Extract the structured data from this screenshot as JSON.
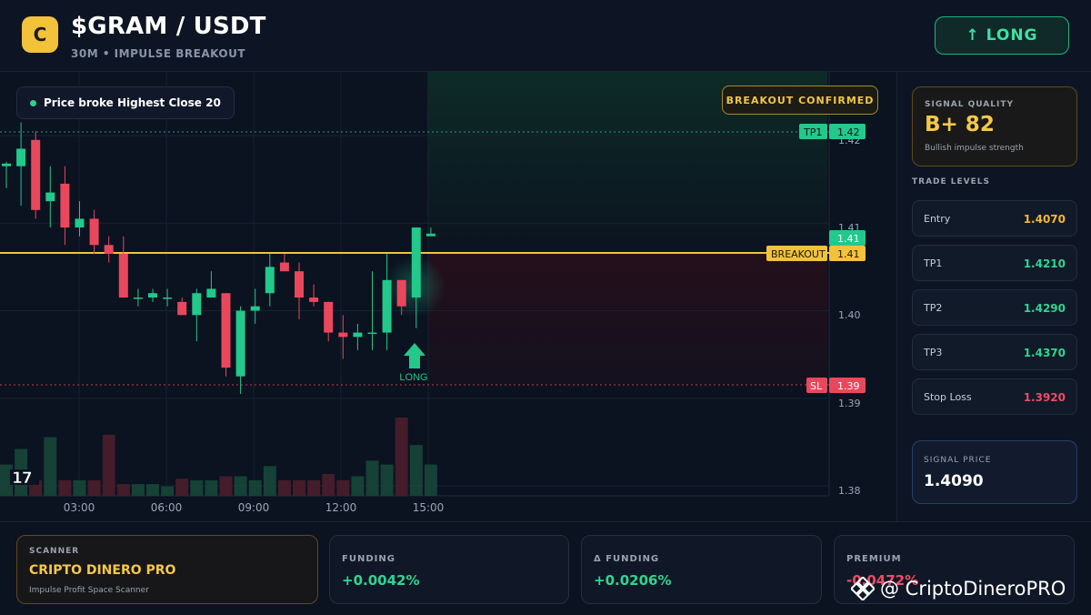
{
  "header": {
    "logo_letter": "C",
    "pair": "$GRAM / USDT",
    "subtitle": "30M • IMPULSE BREAKOUT",
    "direction_button": "↑ LONG"
  },
  "chart": {
    "status_pill": "Price broke Highest Close 20",
    "confirmed_badge": "BREAKOUT CONFIRMED",
    "price_ticks": [
      "1.42",
      "1.41",
      "1.40",
      "1.39",
      "1.38"
    ],
    "time_ticks": [
      "03:00",
      "06:00",
      "09:00",
      "12:00",
      "15:00"
    ],
    "tags": {
      "tp1_label": "TP1",
      "tp1_value": "1.42",
      "current_value": "1.41",
      "breakout_label": "BREAKOUT",
      "breakout_value": "1.41",
      "sl_label": "SL",
      "sl_value": "1.39"
    },
    "long_marker": "LONG",
    "tv_logo": "17",
    "colors": {
      "up": "#22c98a",
      "down": "#e9485c",
      "breakout_line": "#f2c23a"
    }
  },
  "chart_data": {
    "type": "candlestick",
    "x_ticks": [
      "03:00",
      "06:00",
      "09:00",
      "12:00",
      "15:00"
    ],
    "y_ticks": [
      1.42,
      1.41,
      1.4,
      1.39,
      1.38
    ],
    "ylim": [
      1.38,
      1.425
    ],
    "lines": [
      {
        "name": "TP1",
        "value": 1.421
      },
      {
        "name": "BREAKOUT",
        "value": 1.407
      },
      {
        "name": "SL",
        "value": 1.392
      }
    ],
    "candles": [
      {
        "o": 1.4165,
        "h": 1.417,
        "l": 1.414,
        "c": 1.4168
      },
      {
        "o": 1.4165,
        "h": 1.4215,
        "l": 1.412,
        "c": 1.4185
      },
      {
        "o": 1.4195,
        "h": 1.4205,
        "l": 1.4105,
        "c": 1.4115
      },
      {
        "o": 1.4125,
        "h": 1.4165,
        "l": 1.4095,
        "c": 1.4135
      },
      {
        "o": 1.4145,
        "h": 1.4165,
        "l": 1.4075,
        "c": 1.4095
      },
      {
        "o": 1.4095,
        "h": 1.4125,
        "l": 1.4085,
        "c": 1.4105
      },
      {
        "o": 1.4105,
        "h": 1.4115,
        "l": 1.4065,
        "c": 1.4075
      },
      {
        "o": 1.4075,
        "h": 1.4085,
        "l": 1.4055,
        "c": 1.4065
      },
      {
        "o": 1.4065,
        "h": 1.4085,
        "l": 1.4015,
        "c": 1.4015
      },
      {
        "o": 1.4015,
        "h": 1.4025,
        "l": 1.4005,
        "c": 1.4015
      },
      {
        "o": 1.4015,
        "h": 1.4025,
        "l": 1.401,
        "c": 1.402
      },
      {
        "o": 1.4015,
        "h": 1.4025,
        "l": 1.4005,
        "c": 1.4015
      },
      {
        "o": 1.401,
        "h": 1.4015,
        "l": 1.3995,
        "c": 1.3995
      },
      {
        "o": 1.3995,
        "h": 1.4025,
        "l": 1.3965,
        "c": 1.402
      },
      {
        "o": 1.4015,
        "h": 1.4045,
        "l": 1.4015,
        "c": 1.4025
      },
      {
        "o": 1.402,
        "h": 1.402,
        "l": 1.3925,
        "c": 1.3935
      },
      {
        "o": 1.3925,
        "h": 1.4005,
        "l": 1.3905,
        "c": 1.4
      },
      {
        "o": 1.4,
        "h": 1.4025,
        "l": 1.3985,
        "c": 1.4005
      },
      {
        "o": 1.402,
        "h": 1.4065,
        "l": 1.4005,
        "c": 1.405
      },
      {
        "o": 1.4055,
        "h": 1.4065,
        "l": 1.4045,
        "c": 1.4045
      },
      {
        "o": 1.4045,
        "h": 1.4055,
        "l": 1.399,
        "c": 1.4015
      },
      {
        "o": 1.4015,
        "h": 1.403,
        "l": 1.4005,
        "c": 1.401
      },
      {
        "o": 1.401,
        "h": 1.401,
        "l": 1.3965,
        "c": 1.3975
      },
      {
        "o": 1.3975,
        "h": 1.3995,
        "l": 1.3945,
        "c": 1.397
      },
      {
        "o": 1.397,
        "h": 1.3985,
        "l": 1.3955,
        "c": 1.3975
      },
      {
        "o": 1.3975,
        "h": 1.4045,
        "l": 1.3955,
        "c": 1.3975
      },
      {
        "o": 1.3975,
        "h": 1.4065,
        "l": 1.3955,
        "c": 1.4035
      },
      {
        "o": 1.4035,
        "h": 1.4035,
        "l": 1.3995,
        "c": 1.4005
      },
      {
        "o": 1.4015,
        "h": 1.4095,
        "l": 1.398,
        "c": 1.4095
      },
      {
        "o": 1.4085,
        "h": 1.4095,
        "l": 1.4085,
        "c": 1.4088
      }
    ],
    "volume": [
      0.4,
      0.6,
      0.2,
      0.75,
      0.2,
      0.2,
      0.2,
      0.78,
      0.15,
      0.15,
      0.15,
      0.12,
      0.22,
      0.2,
      0.2,
      0.25,
      0.25,
      0.2,
      0.38,
      0.2,
      0.2,
      0.2,
      0.28,
      0.2,
      0.25,
      0.45,
      0.4,
      1.0,
      0.65,
      0.4
    ]
  },
  "sidebar": {
    "quality_label": "SIGNAL QUALITY",
    "quality_value": "B+ 82",
    "quality_desc": "Bullish impulse strength",
    "levels_title": "TRADE LEVELS",
    "levels": [
      {
        "name": "Entry",
        "price": "1.4070",
        "color": "#f5b731"
      },
      {
        "name": "TP1",
        "price": "1.4210",
        "color": "#2ed58f"
      },
      {
        "name": "TP2",
        "price": "1.4290",
        "color": "#2ed58f"
      },
      {
        "name": "TP3",
        "price": "1.4370",
        "color": "#2ed58f"
      },
      {
        "name": "Stop Loss",
        "price": "1.3920",
        "color": "#f24a63"
      }
    ],
    "signal_price_label": "SIGNAL PRICE",
    "signal_price": "1.4090"
  },
  "footer": {
    "scanner_label": "SCANNER",
    "scanner_name": "CRIPTO DINERO PRO",
    "scanner_desc": "Impulse Profit Space Scanner",
    "funding_label": "FUNDING",
    "funding_value": "+0.0042%",
    "delta_label": "Δ FUNDING",
    "delta_value": "+0.0206%",
    "premium_label": "PREMIUM",
    "premium_value": "-0.0472%"
  },
  "watermark": {
    "text": "@ CriptoDineroPRO"
  }
}
